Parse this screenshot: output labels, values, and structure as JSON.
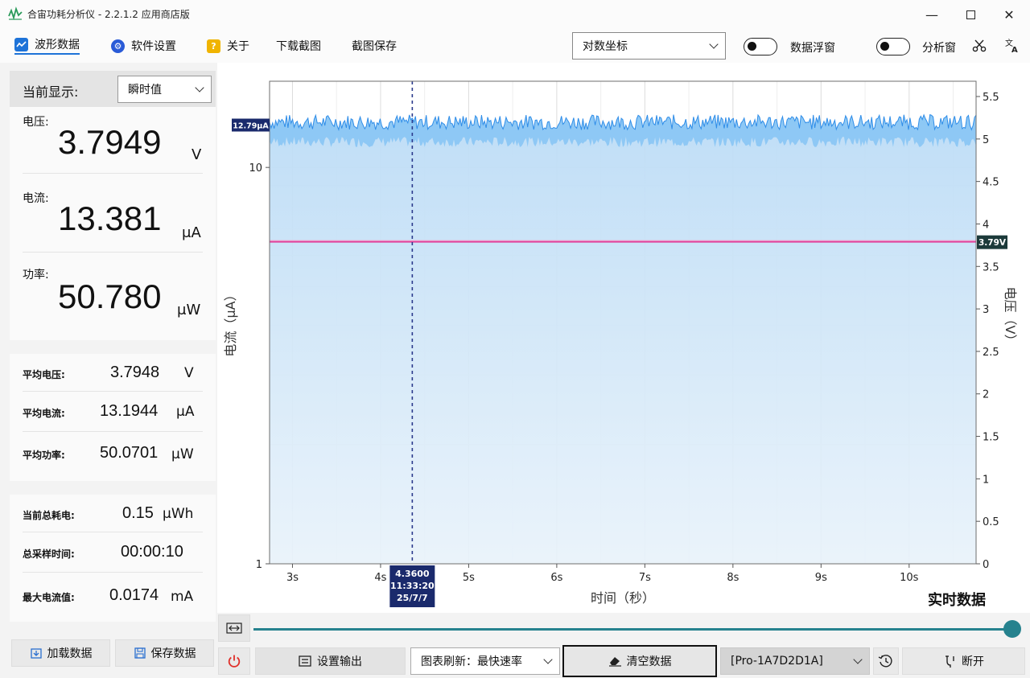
{
  "window": {
    "title": "合宙功耗分析仪 - 2.2.1.2 应用商店版"
  },
  "menu": {
    "waveform": "波形数据",
    "settings": "软件设置",
    "about": "关于",
    "download_chart": "下载截图",
    "screenshot_save": "截图保存",
    "scale_select": "对数坐标",
    "data_float_label": "数据浮窗",
    "analysis_label": "分析窗"
  },
  "panel": {
    "display_label": "当前显示:",
    "display_select": "瞬时值",
    "voltage_label": "电压:",
    "voltage_value": "3.7949",
    "voltage_unit": "V",
    "current_label": "电流:",
    "current_value": "13.381",
    "current_unit": "μA",
    "power_label": "功率:",
    "power_value": "50.780",
    "power_unit": "μW",
    "avg_voltage_label": "平均电压:",
    "avg_voltage_value": "3.7948",
    "avg_voltage_unit": "V",
    "avg_current_label": "平均电流:",
    "avg_current_value": "13.1944",
    "avg_current_unit": "μA",
    "avg_power_label": "平均功率:",
    "avg_power_value": "50.0701",
    "avg_power_unit": "μW",
    "energy_label": "当前总耗电:",
    "energy_value": "0.15",
    "energy_unit": "μWh",
    "sample_time_label": "总采样时间:",
    "sample_time_value": "00:00:10",
    "max_current_label": "最大电流值:",
    "max_current_value": "0.0174",
    "max_current_unit": "mA",
    "load_button": "加载数据",
    "save_button": "保存数据"
  },
  "chart_data": {
    "type": "area",
    "title": "实时数据",
    "xlabel": "时间（秒）",
    "ylabel_left": "电流（μA）",
    "ylabel_right": "电压（V）",
    "x_ticks": [
      "3s",
      "4s",
      "5s",
      "6s",
      "7s",
      "8s",
      "9s",
      "10s"
    ],
    "xlim": [
      2.74,
      10.76
    ],
    "y_left_scale": "log",
    "y_left_ticks": [
      "1",
      "10"
    ],
    "y_left_lim": [
      1,
      16.5
    ],
    "y_right_ticks": [
      "0",
      "0.5",
      "1",
      "1.5",
      "2",
      "2.5",
      "3",
      "3.5",
      "4",
      "4.5",
      "5",
      "5.5"
    ],
    "y_right_lim": [
      0,
      5.68
    ],
    "series": [
      {
        "name": "电流",
        "unit": "μA",
        "baseline": 12.79,
        "noise_low": 11.6,
        "noise_high": 13.6,
        "color": "#2f8de8"
      },
      {
        "name": "电压",
        "unit": "V",
        "value": 3.79,
        "color": "#e0409a"
      }
    ],
    "current_marker_label": "12.79μA",
    "voltage_marker_label": "3.79V",
    "cursor": {
      "x": 4.36,
      "label": [
        "4.3600",
        "11:33:20",
        "25/7/7"
      ]
    },
    "grid": true
  },
  "bottom": {
    "set_output": "设置输出",
    "refresh_select": "图表刷新：最快速率",
    "clear_button": "清空数据",
    "device_select": "[Pro-1A7D2D1A]",
    "disconnect_button": "断开"
  },
  "colors": {
    "accent": "#1e73d8",
    "current_line": "#2f8de8",
    "voltage_line": "#e0409a",
    "marker_dark": "#1a2a6c",
    "voltage_tag": "#1c3a3a",
    "power_red": "#e0302a"
  }
}
